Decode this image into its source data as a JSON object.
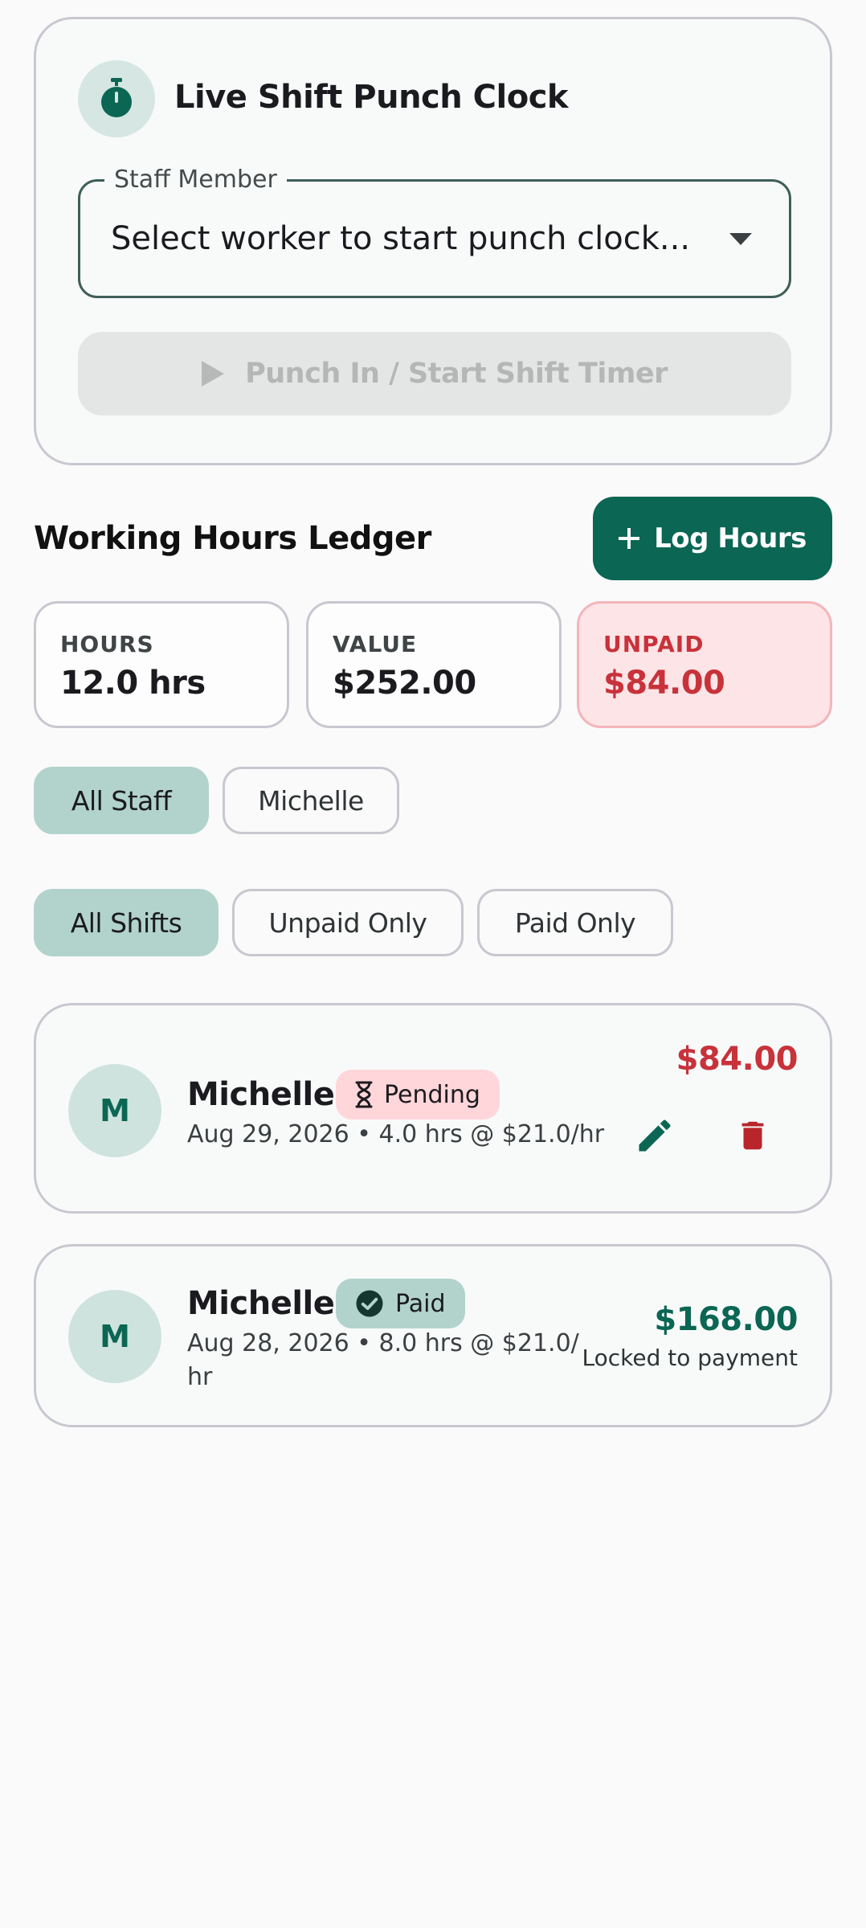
{
  "punch_clock": {
    "title": "Live Shift Punch Clock",
    "staff_field": {
      "label": "Staff Member",
      "placeholder": "Select worker to start punch clock..."
    },
    "start_button_label": "Punch In / Start Shift Timer"
  },
  "ledger": {
    "title": "Working Hours Ledger",
    "log_button_label": "Log Hours",
    "stats": [
      {
        "label": "HOURS",
        "value": "12.0 hrs"
      },
      {
        "label": "VALUE",
        "value": "$252.00"
      },
      {
        "label": "UNPAID",
        "value": "$84.00"
      }
    ],
    "staff_filters": [
      "All Staff",
      "Michelle"
    ],
    "selected_staff_filter": "All Staff",
    "status_filters": [
      "All Shifts",
      "Unpaid Only",
      "Paid Only"
    ],
    "selected_status_filter": "All Shifts",
    "shifts": [
      {
        "initial": "M",
        "name": "Michelle",
        "status": "Pending",
        "date_line": "Aug 29, 2026 • 4.0 hrs @ $21.0/hr",
        "amount": "$84.00"
      },
      {
        "initial": "M",
        "name": "Michelle",
        "status": "Paid",
        "date_line_1": "Aug 28, 2026 • 8.0 hrs @ $21.0/",
        "date_line_2": "hr",
        "amount": "$168.00",
        "note": "Locked to payment"
      }
    ]
  },
  "colors": {
    "primary": "#0b6654",
    "unpaid": "#c8323a",
    "chip_selected": "#b2d3cc",
    "pending_badge": "#ffd6da"
  }
}
